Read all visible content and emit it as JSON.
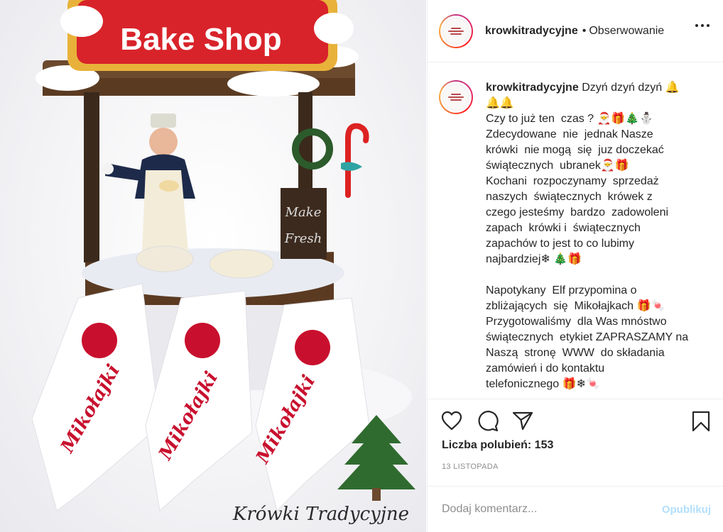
{
  "photo": {
    "sign_text": "Bake Shop",
    "chalkboard_text_1": "Make",
    "chalkboard_text_2": "Fresh",
    "package_text": "Mikołajki",
    "watermark": "Krówki Tradycyjne",
    "colors": {
      "sign_red": "#d8232a",
      "sign_gold": "#e8b23a",
      "package_red": "#c8102e"
    }
  },
  "post": {
    "username": "krowkitradycyjne",
    "separator": "•",
    "follow_status": "Obserwowanie",
    "more_icon": "more-dots-icon",
    "caption": "Dzyń dzyń dzyń 🔔\n🔔🔔\nCzy to już ten  czas ? 🎅🎁🎄⛄\nZdecydowane  nie  jednak Nasze\nkrówki  nie mogą  się  juz doczekać\nświątecznych  ubranek🎅🎁\nKochani  rozpoczynamy  sprzedaż\nnaszych  świątecznych  krówek z\nczego jesteśmy  bardzo  zadowoleni\nzapach  krówki i  świątecznych\nzapachów to jest to co lubimy\nnajbardziej❄ 🎄🎁\n\nNapotykany  Elf przypomina o\nzbliżających  się  Mikołajkach 🎁🍬\nPrzygotowaliśmy  dla Was mnóstwo\nświątecznych  etykiet ZAPRASZAMY na\nNaszą  stronę  WWW  do składania\nzamówień i do kontaktu\ntelefonicznego 🎁❄🍬",
    "actions": {
      "like_icon": "heart-icon",
      "comment_icon": "comment-icon",
      "share_icon": "send-icon",
      "save_icon": "bookmark-icon"
    },
    "likes_label": "Liczba polubień: 153",
    "date": "13 LISTOPADA",
    "comment_placeholder": "Dodaj komentarz...",
    "publish_label": "Opublikuj"
  }
}
